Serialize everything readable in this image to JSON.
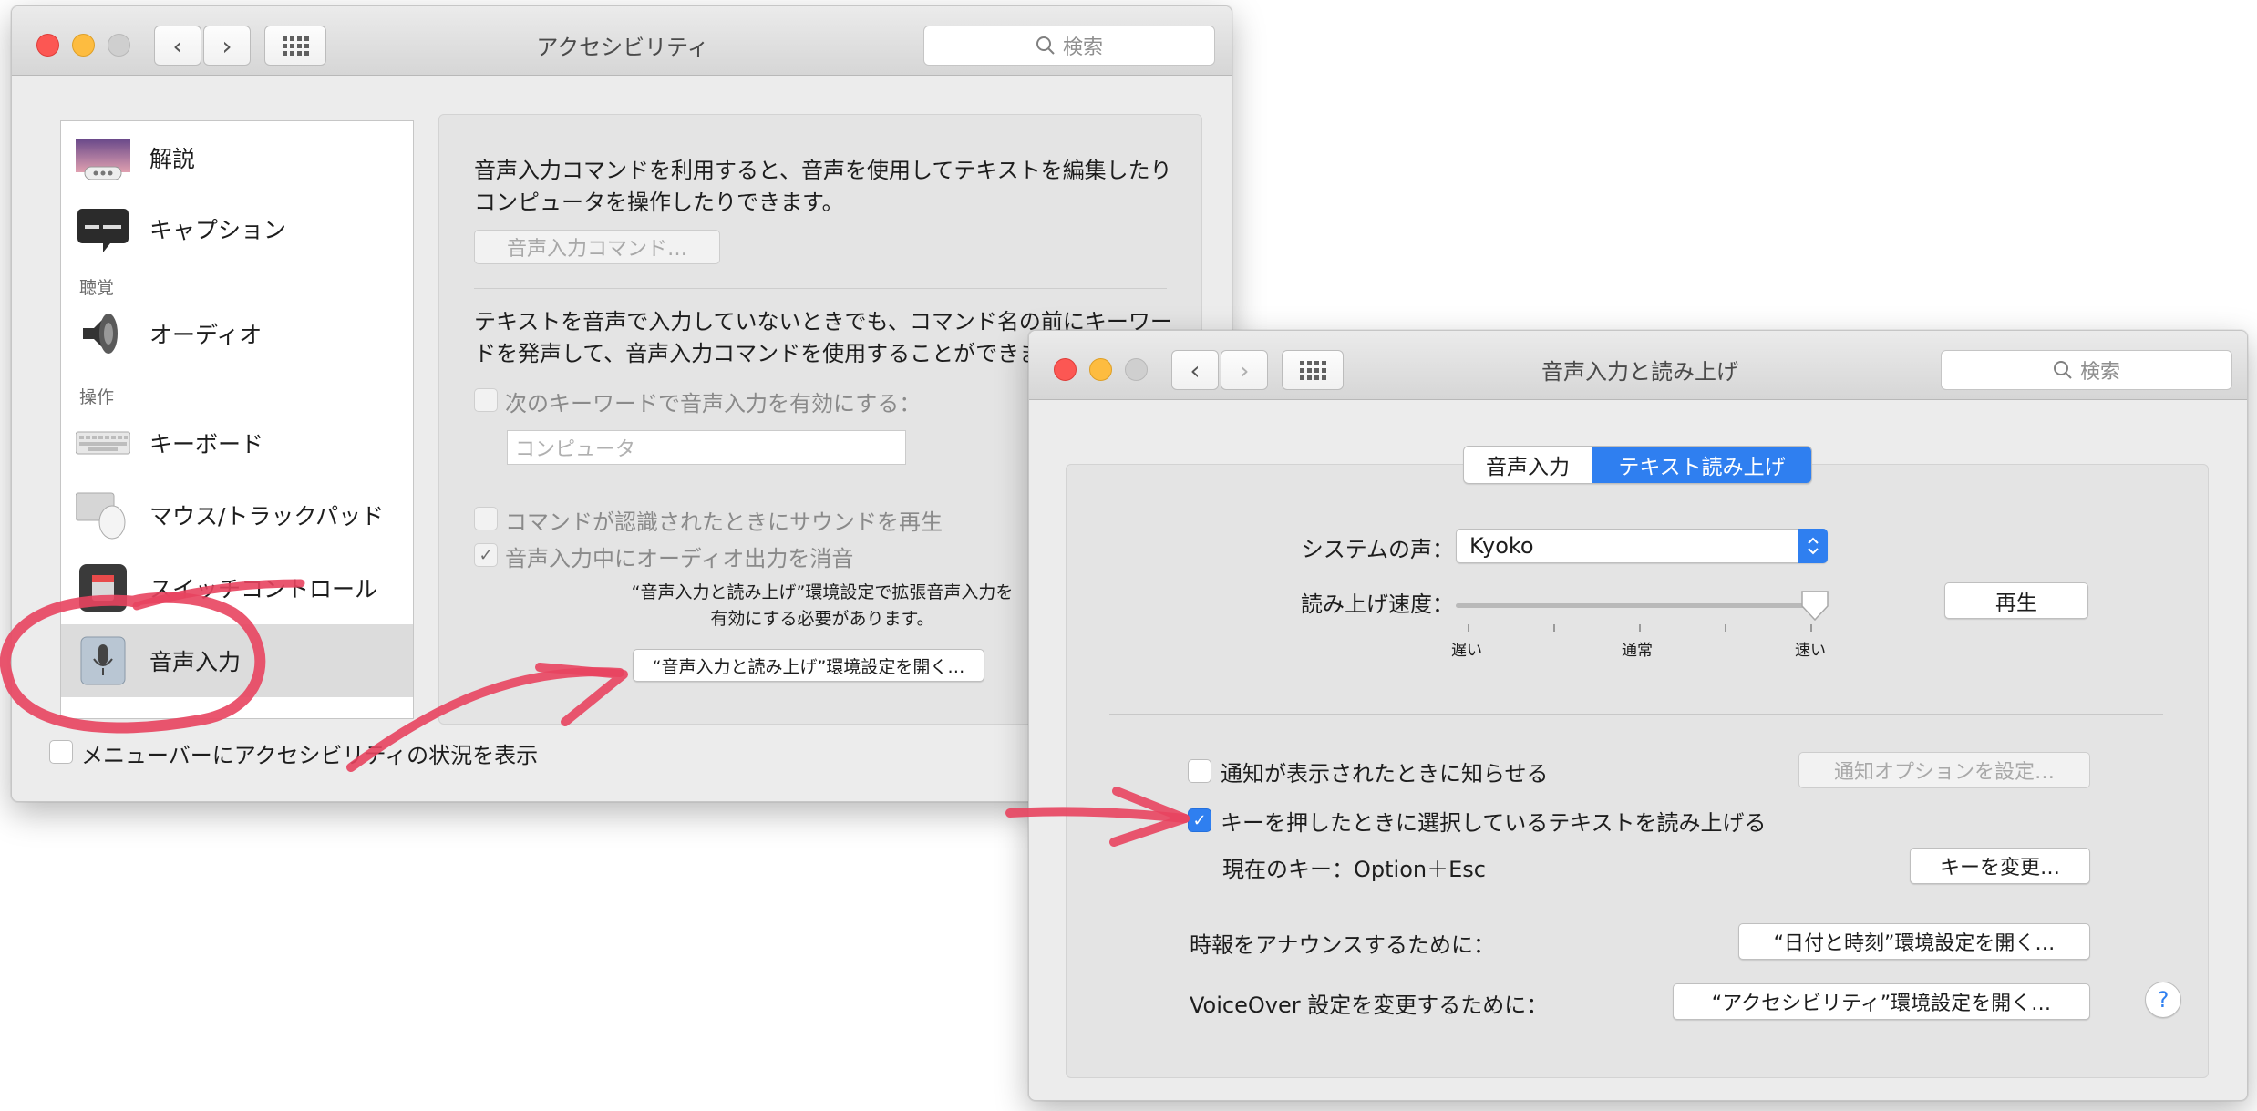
{
  "window1": {
    "title": "アクセシビリティ",
    "search_placeholder": "検索",
    "sidebar": {
      "items": [
        {
          "label": "解説",
          "icon": "description-icon"
        },
        {
          "label": "キャプション",
          "icon": "captions-icon"
        },
        {
          "label": "オーディオ",
          "icon": "speaker-icon"
        },
        {
          "label": "キーボード",
          "icon": "keyboard-icon"
        },
        {
          "label": "マウス/トラックパッド",
          "icon": "mouse-icon"
        },
        {
          "label": "スイッチコントロール",
          "icon": "switch-control-icon"
        },
        {
          "label": "音声入力",
          "icon": "microphone-icon",
          "selected": true
        }
      ],
      "categories": {
        "hearing": "聴覚",
        "interaction": "操作"
      }
    },
    "panel": {
      "intro_line1": "音声入力コマンドを利用すると、音声を使用してテキストを編集したり",
      "intro_line2": "コンピュータを操作したりできます。",
      "commands_button": "音声入力コマンド…",
      "keyword_line1": "テキストを音声で入力していないときでも、コマンド名の前にキーワー",
      "keyword_line2": "ドを発声して、音声入力コマンドを使用することができます",
      "keyword_checkbox": "次のキーワードで音声入力を有効にする：",
      "keyword_placeholder": "コンピュータ",
      "sound_checkbox": "コマンドが認識されたときにサウンドを再生",
      "mute_checkbox": "音声入力中にオーディオ出力を消音",
      "note_line1": "“音声入力と読み上げ”環境設定で拡張音声入力を",
      "note_line2": "有効にする必要があります。",
      "open_button": "“音声入力と読み上げ”環境設定を開く…"
    },
    "menubar_checkbox": "メニューバーにアクセシビリティの状況を表示"
  },
  "window2": {
    "title": "音声入力と読み上げ",
    "search_placeholder": "検索",
    "tabs": [
      {
        "label": "音声入力",
        "selected": false
      },
      {
        "label": "テキスト読み上げ",
        "selected": true
      }
    ],
    "voice_label": "システムの声：",
    "voice_value": "Kyoko",
    "rate_label": "読み上げ速度：",
    "rate_ticks": {
      "slow": "遅い",
      "normal": "通常",
      "fast": "速い"
    },
    "rate_value": 1.0,
    "play_button": "再生",
    "notify_checkbox": "通知が表示されたときに知らせる",
    "notify_button": "通知オプションを設定…",
    "speak_checkbox": "キーを押したときに選択しているテキストを読み上げる",
    "current_key": "現在のキー：Option＋Esc",
    "change_key_button": "キーを変更…",
    "announce_label": "時報をアナウンスするために：",
    "announce_button": "“日付と時刻”環境設定を開く…",
    "voiceover_label": "VoiceOver 設定を変更するために：",
    "voiceover_button": "“アクセシビリティ”環境設定を開く…",
    "help_label": "?"
  },
  "colors": {
    "accent": "#2f7ff0",
    "annotation": "#e8445f"
  }
}
